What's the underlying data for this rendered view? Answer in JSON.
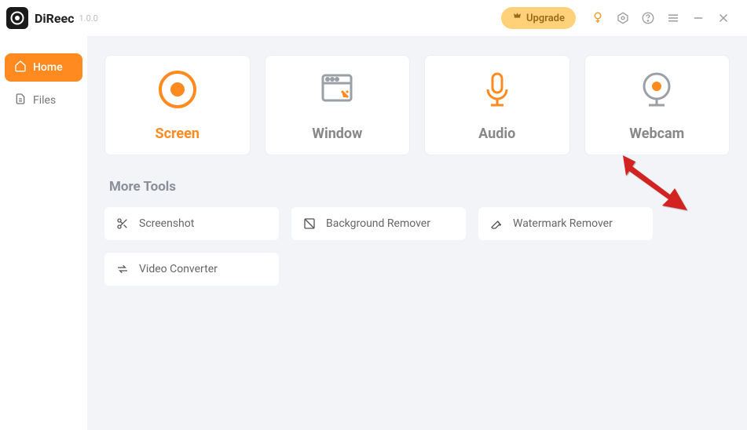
{
  "app": {
    "name": "DiReec",
    "version": "1.0.0"
  },
  "titlebar": {
    "upgrade": "Upgrade"
  },
  "sidebar": {
    "items": [
      {
        "label": "Home",
        "active": true
      },
      {
        "label": "Files",
        "active": false
      }
    ]
  },
  "cards": [
    {
      "label": "Screen",
      "active": true
    },
    {
      "label": "Window",
      "active": false
    },
    {
      "label": "Audio",
      "active": false
    },
    {
      "label": "Webcam",
      "active": false
    }
  ],
  "moreTools": {
    "title": "More Tools",
    "items": [
      {
        "label": "Screenshot"
      },
      {
        "label": "Background Remover"
      },
      {
        "label": "Watermark Remover"
      },
      {
        "label": "Video Converter"
      }
    ]
  },
  "colors": {
    "accent": "#ff8a1f",
    "upgrade": "#ffd27a"
  }
}
